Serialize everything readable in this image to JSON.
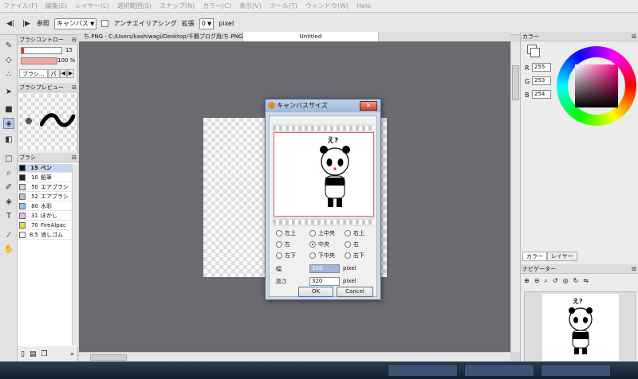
{
  "menu": [
    "ファイル(F)",
    "編集(E)",
    "レイヤー(L)",
    "選択範囲(S)",
    "スナップ(N)",
    "カラー(C)",
    "表示(V)",
    "ツール(T)",
    "ウィンドウ(W)",
    "Help"
  ],
  "options": {
    "ref_label": "参照",
    "ref_value": "キャンバス",
    "antialias_label": "アンチエイリアシング",
    "expand_label": "拡張",
    "expand_value": "0",
    "unit": "pixel"
  },
  "brush_control": {
    "title": "ブラシコントロー",
    "size": "15",
    "opacity": "100 %",
    "tab1": "ブラシ...",
    "tab2": "パ"
  },
  "brush_preview": {
    "title": "ブラシプレビュー"
  },
  "brush_panel": {
    "title": "ブラシ",
    "items": [
      {
        "size": "15",
        "name": "ペン",
        "color": "#111111"
      },
      {
        "size": "10",
        "name": "鉛筆",
        "color": "#222222"
      },
      {
        "size": "50",
        "name": "エアブラシ",
        "color": "#d0d0d0"
      },
      {
        "size": "52",
        "name": "エアブラシ",
        "color": "#bfbfbf"
      },
      {
        "size": "80",
        "name": "水彩",
        "color": "#7fc8ff"
      },
      {
        "size": "31",
        "name": "ぼかし",
        "color": "#e3b8ff"
      },
      {
        "size": "70",
        "name": "FireAlpac",
        "color": "#e7d84a"
      },
      {
        "size": "8.5",
        "name": "消しゴム",
        "color": "#ffffff"
      }
    ]
  },
  "tabs": [
    "ち.PNG - C:/Users/kashiwagi/Desktop/千鶴ブログ用/ち.PNG",
    "Untitled"
  ],
  "color_panel": {
    "title": "カラー",
    "r_label": "R",
    "r": "255",
    "g_label": "G",
    "g": "253",
    "b_label": "B",
    "b": "254"
  },
  "layer_tabs": [
    "カラー",
    "レイヤー"
  ],
  "navigator": {
    "title": "ナビゲーター"
  },
  "dialog": {
    "title": "キャンバスサイズ",
    "anchors": [
      "左上",
      "上中央",
      "右上",
      "左",
      "中央",
      "右",
      "左下",
      "下中央",
      "右下"
    ],
    "selected_anchor": "中央",
    "width_label": "幅",
    "width_value": "320",
    "height_label": "高さ",
    "height_value": "320",
    "unit": "pixel",
    "ok": "OK",
    "cancel": "Cancel",
    "preview_text": "え?"
  },
  "nav_preview_text": "え?"
}
